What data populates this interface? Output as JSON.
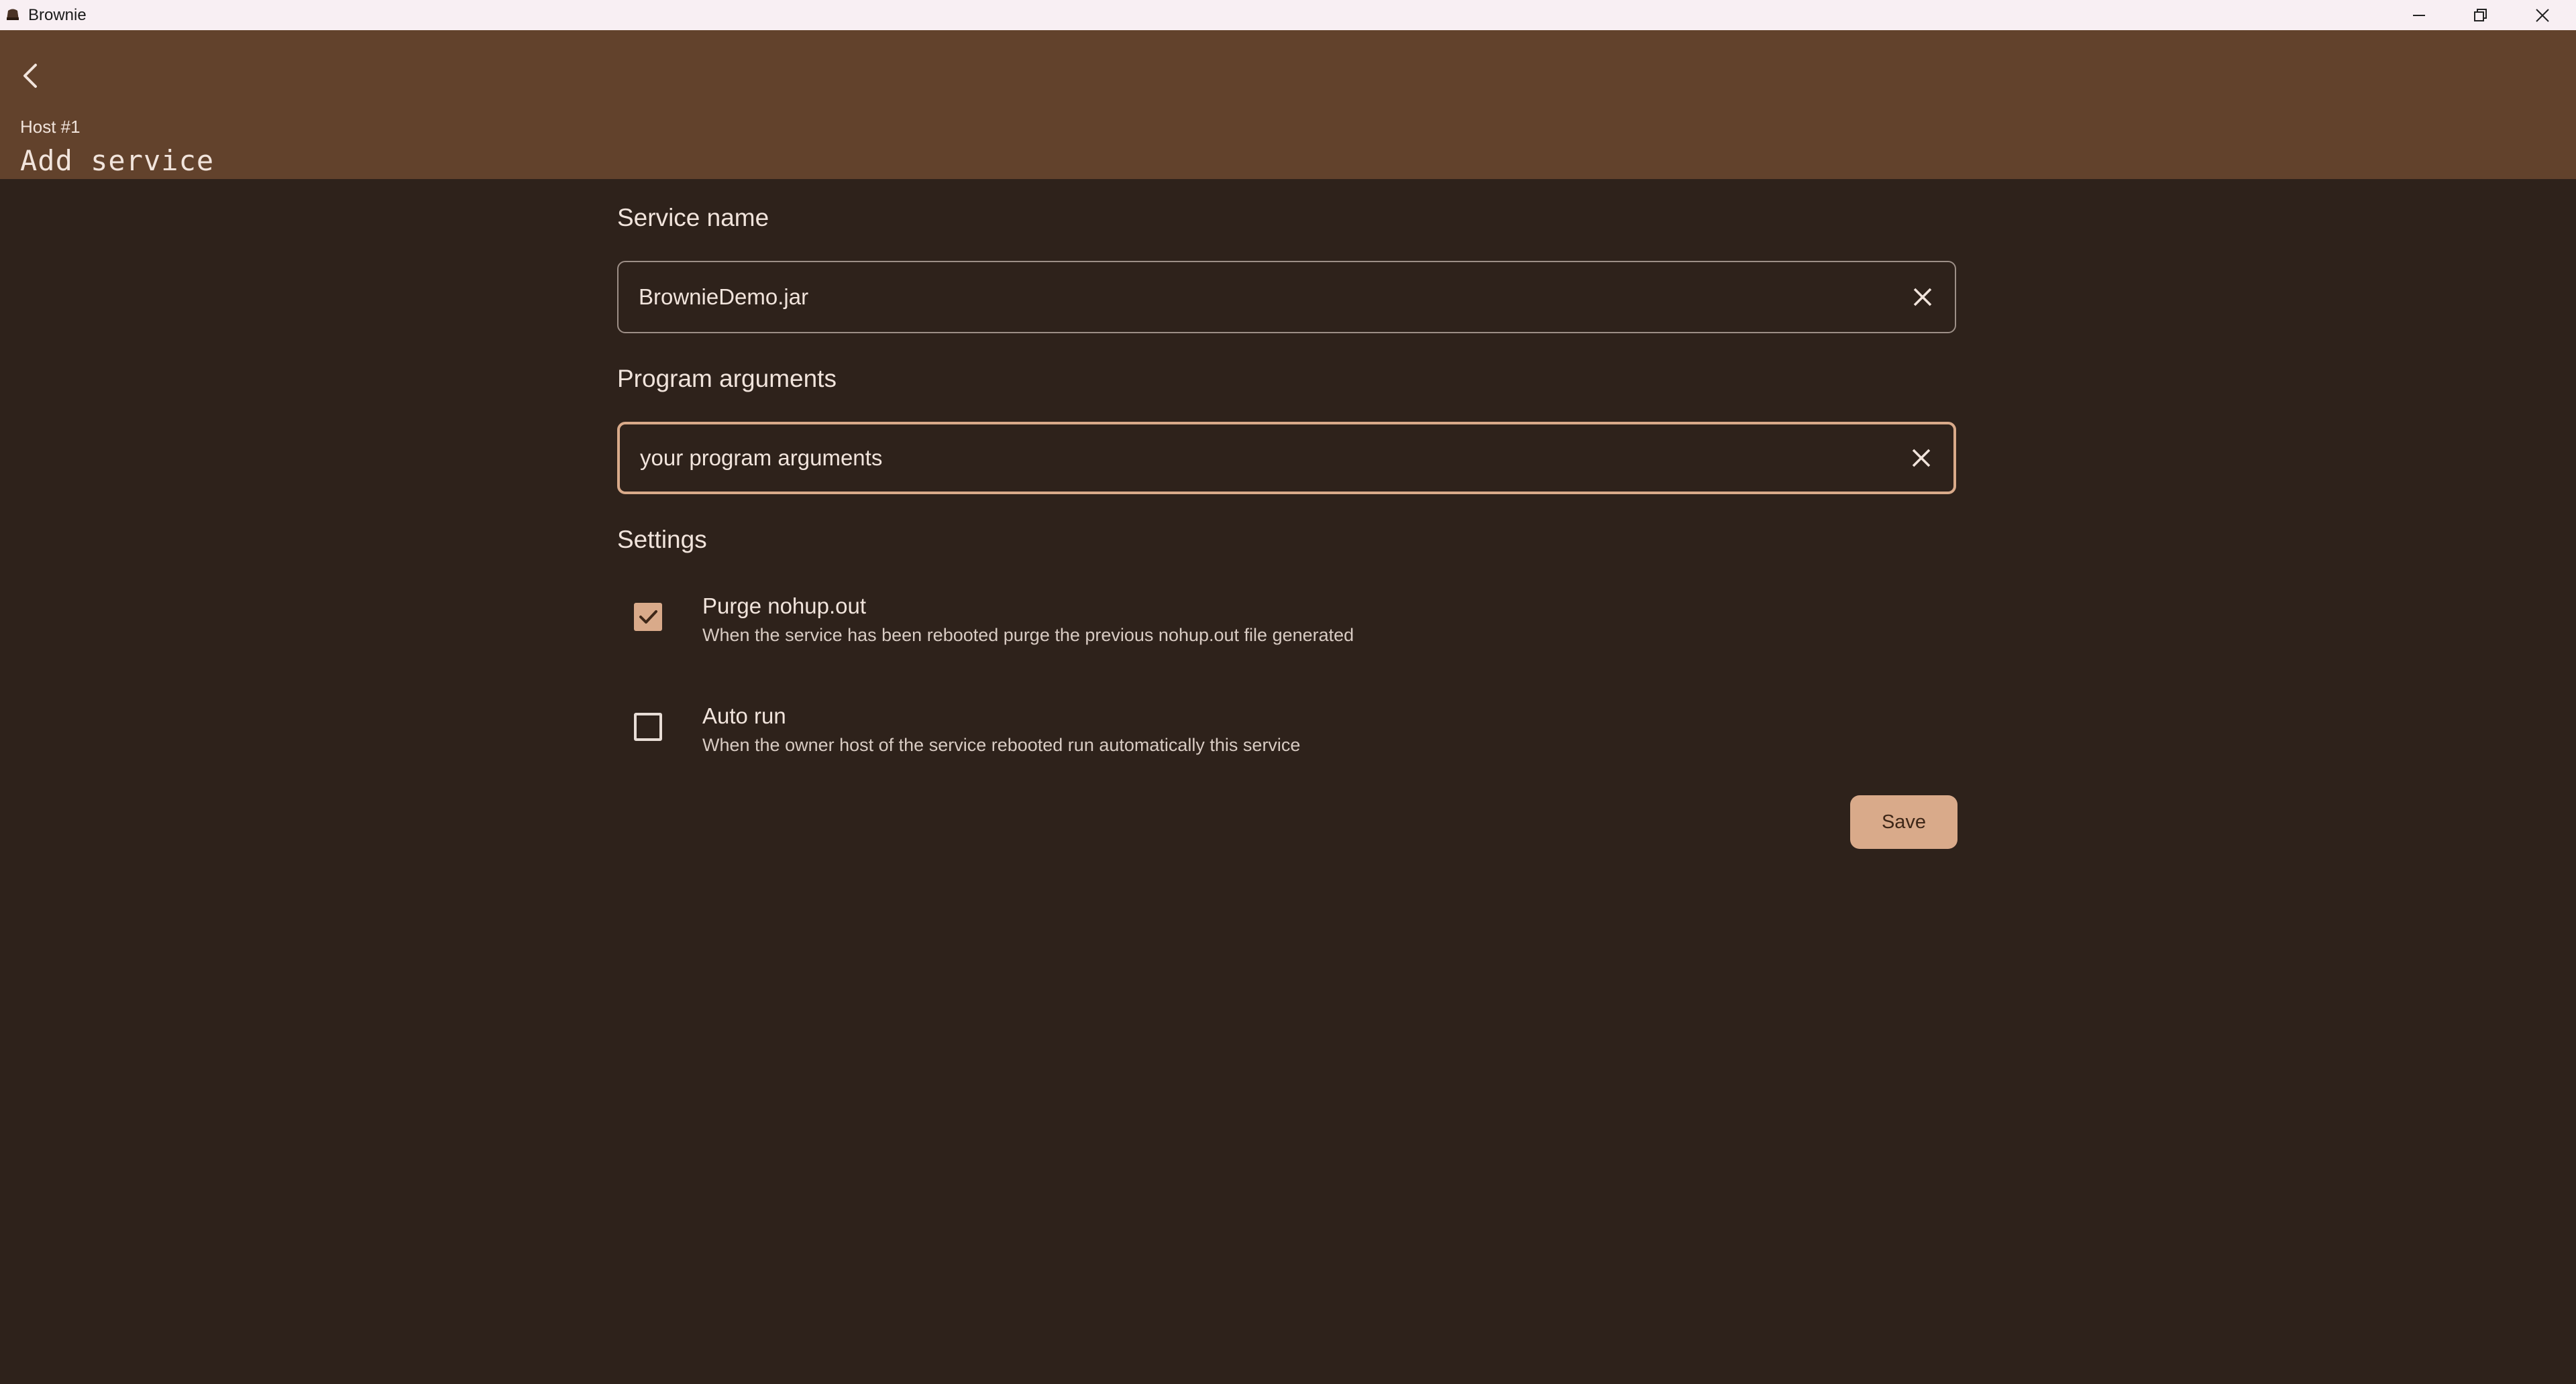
{
  "window": {
    "title": "Brownie",
    "controls": [
      "minimize",
      "restore",
      "close"
    ]
  },
  "header": {
    "back_icon": "chevron-left-icon",
    "subtitle": "Host #1",
    "title": "Add service"
  },
  "form": {
    "service_name": {
      "label": "Service name",
      "value": "BrownieDemo.jar",
      "clear_icon": "close-icon"
    },
    "program_arguments": {
      "label": "Program arguments",
      "value": "your program arguments",
      "clear_icon": "close-icon",
      "focused": true
    },
    "settings": {
      "label": "Settings",
      "items": [
        {
          "title": "Purge nohup.out",
          "description": "When the service has been rebooted purge the previous nohup.out file generated",
          "checked": true
        },
        {
          "title": "Auto run",
          "description": "When the owner host of the service rebooted run automatically this service",
          "checked": false
        }
      ]
    },
    "save_label": "Save"
  },
  "colors": {
    "header_bg": "#62422c",
    "page_bg": "#2e221b",
    "accent": "#d9aa8a",
    "titlebar_bg": "#f8eff3"
  }
}
